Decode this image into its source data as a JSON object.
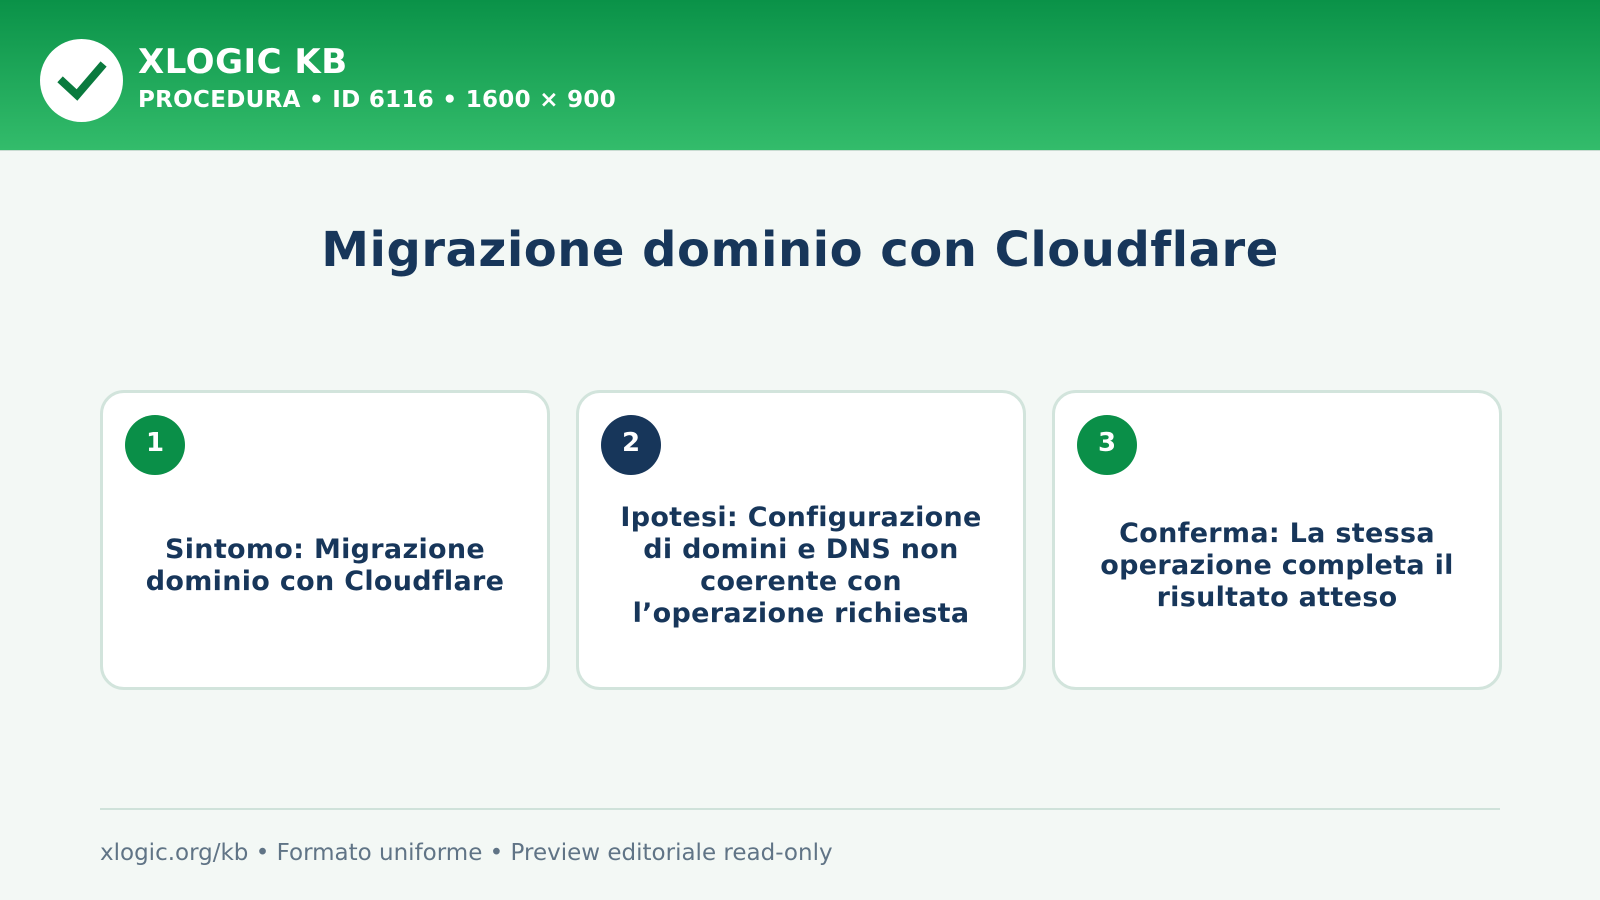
{
  "header": {
    "logo_icon": "checkmark-icon",
    "brand": "XLOGIC KB",
    "subline": "PROCEDURA • ID 6116 • 1600 × 900"
  },
  "main": {
    "title": "Migrazione dominio con Cloudflare",
    "cards": [
      {
        "step": "1",
        "text": "Sintomo: Migrazione dominio con Cloudflare",
        "badge_color": "#0a8f48"
      },
      {
        "step": "2",
        "text": "Ipotesi: Configurazione di domini e DNS non coerente con l’operazione richiesta",
        "badge_color": "#17365a"
      },
      {
        "step": "3",
        "text": "Conferma: La stessa operazione completa il risultato atteso",
        "badge_color": "#0a8f48"
      }
    ]
  },
  "footer": {
    "text": "xlogic.org/kb • Formato uniforme • Preview editoriale read-only"
  },
  "colors": {
    "header_top": "#0a9248",
    "header_bottom": "#33bc6b",
    "title": "#17365a",
    "background": "#f3f8f5"
  }
}
